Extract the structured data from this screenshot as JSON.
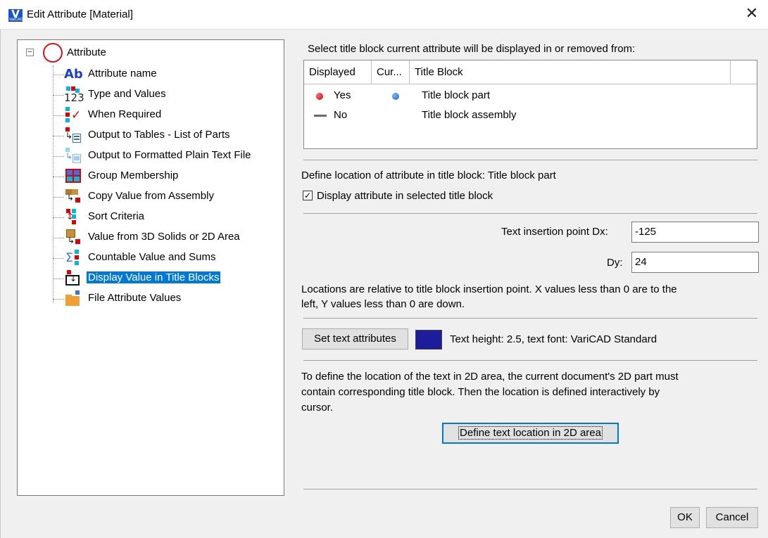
{
  "window": {
    "title": "Edit Attribute [Material]",
    "app_icon_letter": "V",
    "app_icon_caption": "VariCAD",
    "close_glyph": "✕"
  },
  "tree": {
    "root": {
      "label": "Attribute",
      "expander": "−",
      "icon": "red-circle-icon"
    },
    "items": [
      {
        "label": "Attribute name",
        "icon": "ab-text-icon"
      },
      {
        "label": "Type and Values",
        "icon": "type-123-icon"
      },
      {
        "label": "When Required",
        "icon": "red-check-icon"
      },
      {
        "label": "Output to Tables - List of Parts",
        "icon": "table-output-icon"
      },
      {
        "label": "Output to Formatted Plain Text File",
        "icon": "text-file-output-icon"
      },
      {
        "label": "Group Membership",
        "icon": "group-grid-icon"
      },
      {
        "label": "Copy Value from Assembly",
        "icon": "assembly-copy-icon"
      },
      {
        "label": "Sort Criteria",
        "icon": "sort-arrows-icon"
      },
      {
        "label": "Value from 3D Solids or 2D Area",
        "icon": "solid-box-icon"
      },
      {
        "label": "Countable Value and Sums",
        "icon": "sigma-sum-icon"
      },
      {
        "label": "Display Value in Title Blocks",
        "icon": "title-block-icon",
        "selected": true
      },
      {
        "label": "File Attribute Values",
        "icon": "folder-icon"
      }
    ]
  },
  "title_block_section": {
    "heading": "Select title block current attribute will be displayed in or removed from:",
    "columns": [
      "Displayed",
      "Cur...",
      "Title Block"
    ],
    "rows": [
      {
        "displayed": "Yes",
        "current": true,
        "title_block": "Title block part"
      },
      {
        "displayed": "No",
        "current": false,
        "title_block": "Title block assembly"
      }
    ]
  },
  "location_section": {
    "heading": "Define location of attribute in title block: Title block part",
    "checkbox_label": "Display attribute in selected title block",
    "checkbox_checked": true,
    "checkbox_glyph": "✓",
    "dx_label": "Text insertion point Dx:",
    "dx_value": "-125",
    "dy_label": "Dy:",
    "dy_value": "24",
    "note_line1": "Locations are relative to title block insertion point. X values less than 0 are to the",
    "note_line2": "left, Y values less than 0 are down."
  },
  "text_attributes": {
    "button_label": "Set text attributes",
    "swatch_color": "#1c1c9c",
    "description": "Text height: 2.5, text font: VariCAD Standard"
  },
  "define_location": {
    "line1": "To define the location of the text in 2D area, the current document's 2D part must",
    "line2": "contain corresponding title block. Then the location is defined interactively by",
    "line3": "cursor.",
    "button_label": "Define text location in 2D area"
  },
  "footer": {
    "ok_label": "OK",
    "cancel_label": "Cancel"
  }
}
